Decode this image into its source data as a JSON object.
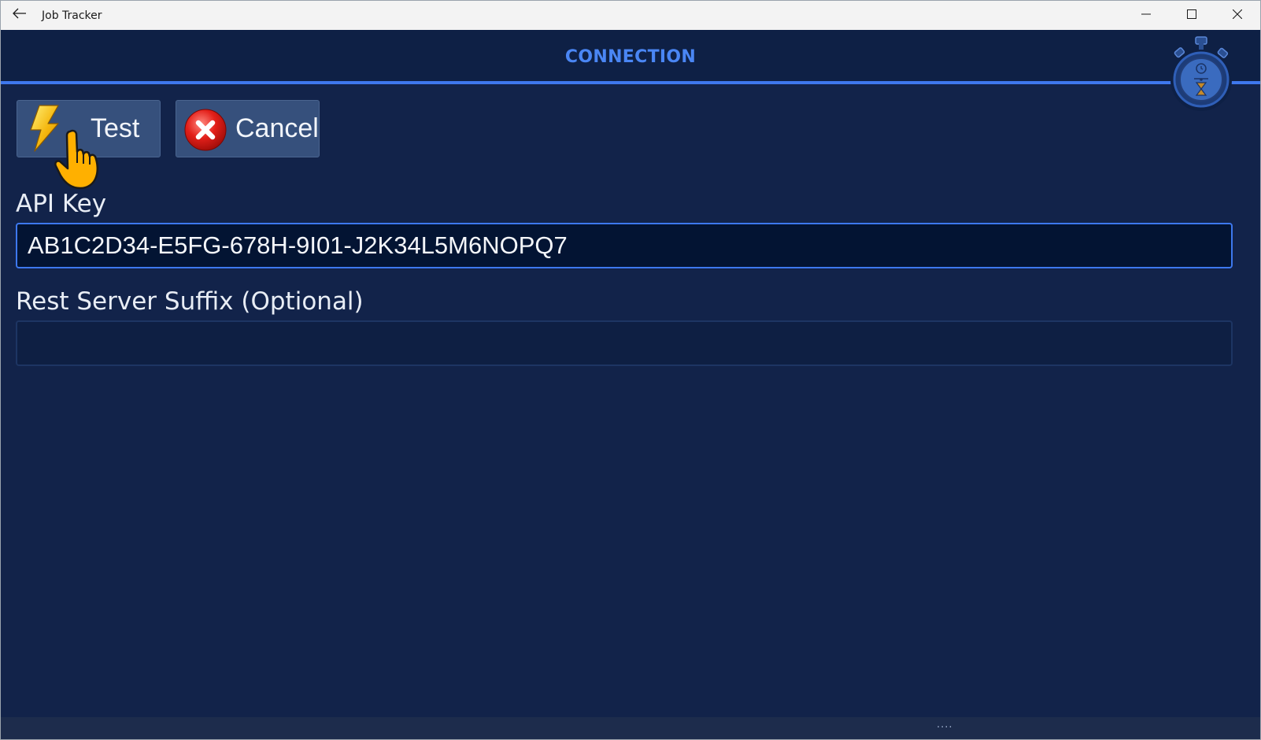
{
  "window": {
    "title": "Job Tracker"
  },
  "header": {
    "title": "CONNECTION",
    "accent_color": "#4a86f4"
  },
  "toolbar": {
    "test_label": "Test",
    "cancel_label": "Cancel"
  },
  "form": {
    "api_key": {
      "label": "API Key",
      "value": "AB1C2D34-E5FG-678H-9I01-J2K34L5M6NOPQ7",
      "focused": true
    },
    "suffix": {
      "label": "Rest Server Suffix (Optional)",
      "value": ""
    }
  },
  "bottombar": {
    "more": "...."
  },
  "icons": {
    "back": "back-arrow-icon",
    "minimize": "minimize-icon",
    "maximize": "maximize-icon",
    "close": "close-icon",
    "test": "lightning-icon",
    "cancel": "cancel-x-icon",
    "logo": "stopwatch-icon",
    "cursor": "hand-cursor-icon"
  }
}
